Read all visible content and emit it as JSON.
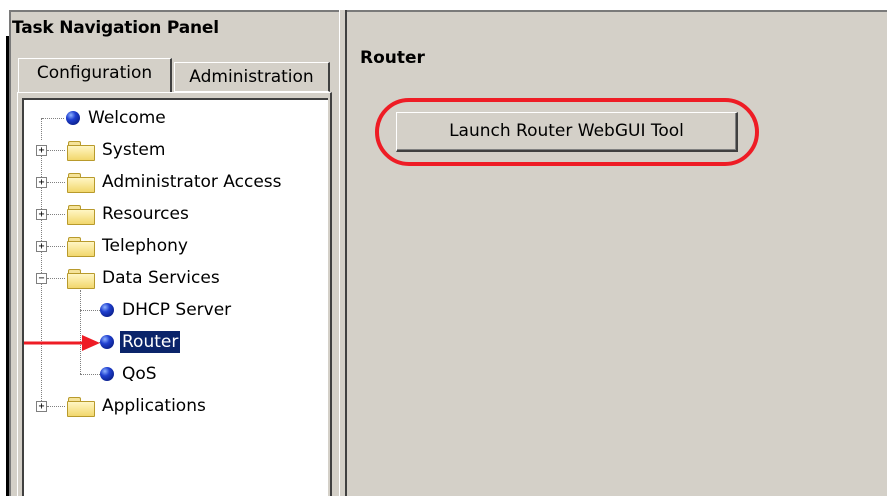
{
  "panel": {
    "title": "Task Navigation Panel",
    "tabs": [
      {
        "label": "Configuration",
        "active": true
      },
      {
        "label": "Administration",
        "active": false
      }
    ]
  },
  "tree": {
    "items": [
      {
        "label": "Welcome",
        "icon": "bullet-icon"
      },
      {
        "label": "System",
        "icon": "folder-icon",
        "expander": "+"
      },
      {
        "label": "Administrator Access",
        "icon": "folder-icon",
        "expander": "+"
      },
      {
        "label": "Resources",
        "icon": "folder-icon",
        "expander": "+"
      },
      {
        "label": "Telephony",
        "icon": "folder-icon",
        "expander": "+"
      },
      {
        "label": "Data Services",
        "icon": "folder-open-icon",
        "expander": "-"
      },
      {
        "label": "DHCP Server",
        "icon": "bullet-icon"
      },
      {
        "label": "Router",
        "icon": "bullet-icon",
        "selected": true
      },
      {
        "label": "QoS",
        "icon": "bullet-icon"
      },
      {
        "label": "Applications",
        "icon": "folder-icon",
        "expander": "+"
      }
    ]
  },
  "content": {
    "title": "Router",
    "launch_button_label": "Launch Router WebGUI Tool"
  },
  "colors": {
    "window_bg": "#d4d0c8",
    "selection_bg": "#0a246a",
    "annotation_red": "#ee1c25"
  }
}
